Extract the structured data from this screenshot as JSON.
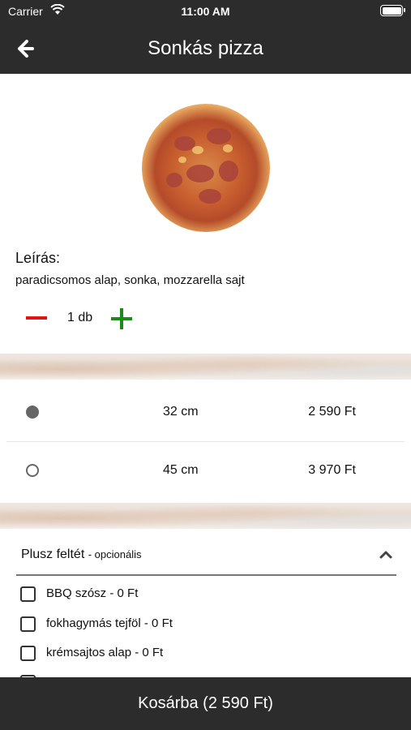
{
  "status_bar": {
    "carrier": "Carrier",
    "time": "11:00 AM"
  },
  "header": {
    "title": "Sonkás pizza"
  },
  "product": {
    "description_heading": "Leírás:",
    "description": "paradicsomos alap, sonka, mozzarella sajt"
  },
  "quantity": {
    "value": "1 db"
  },
  "sizes": [
    {
      "size": "32 cm",
      "price": "2 590 Ft",
      "selected": true
    },
    {
      "size": "45 cm",
      "price": "3 970 Ft",
      "selected": false
    }
  ],
  "extras": {
    "heading": "Plusz feltét",
    "optional_label": "- opcionális",
    "items": [
      {
        "label": "BBQ szósz - 0 Ft"
      },
      {
        "label": "fokhagymás tejföl - 0 Ft"
      },
      {
        "label": "krémsajtos alap - 0 Ft"
      }
    ]
  },
  "cart": {
    "button_label": "Kosárba (2 590 Ft)"
  },
  "colors": {
    "bar": "#2c2c2c",
    "minus": "#e01616",
    "plus": "#1a8a1a"
  }
}
